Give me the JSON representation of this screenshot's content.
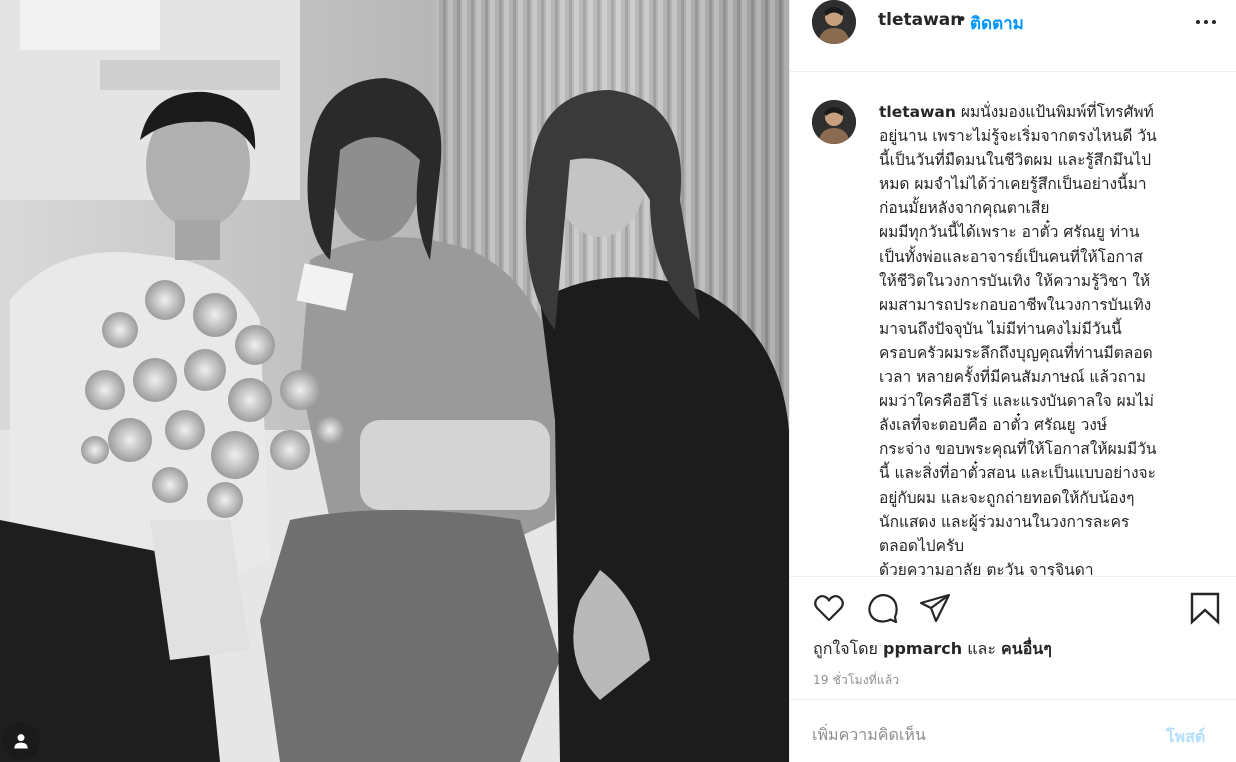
{
  "post": {
    "username": "tletawan",
    "separator": "•",
    "follow_label": "ติดตาม",
    "more_icon": "more-horizontal-icon"
  },
  "caption": {
    "username": "tletawan",
    "lines": [
      "ผมนั่งมองแป้นพิมพ์ที่โทรศัพท์",
      "อยู่นาน เพราะไม่รู้จะเริ่มจากตรงไหนดี วัน",
      "นี้เป็นวันที่มืดมนในชีวิตผม และรู้สึกมึนไป",
      "หมด ผมจำไม่ได้ว่าเคยรู้สึกเป็นอย่างนี้มา",
      "ก่อนมั้ยหลังจากคุณตาเสีย",
      "ผมมีทุกวันนี้ได้เพราะ อาตั๋ว ศรัณยู ท่าน",
      "เป็นทั้งพ่อและอาจารย์เป็นคนที่ให้โอกาส",
      "ให้ชีวิตในวงการบันเทิง ให้ความรู้วิชา ให้",
      "ผมสามารถประกอบอาชีพในวงการบันเทิง",
      "มาจนถึงปัจจุบัน ไม่มีท่านคงไม่มีวันนี้",
      "ครอบครัวผมระลึกถึงบุญคุณที่ท่านมีตลอด",
      "เวลา หลายครั้งที่มีคนสัมภาษณ์ แล้วถาม",
      "ผมว่าใครคือฮีโร่ และแรงบันดาลใจ ผมไม่",
      "ลังเลที่จะตอบคือ อาตั๋ว ศรัณยู วงษ์",
      "กระจ่าง ขอบพระคุณที่ให้โอกาสให้ผมมีวัน",
      "นี้ และสิ่งที่อาตั๋วสอน และเป็นแบบอย่างจะ",
      "อยู่กับผม และจะถูกถ่ายทอดให้กับน้องๆ",
      "นักแสดง และผู้ร่วมงานในวงการละคร",
      "ตลอดไปครับ",
      "ด้วยความอาลัย ตะวัน จารุจินดา"
    ]
  },
  "actions": {
    "like_icon": "heart-icon",
    "comment_icon": "comment-bubble-icon",
    "share_icon": "paper-plane-icon",
    "save_icon": "bookmark-icon"
  },
  "likes": {
    "prefix": "ถูกใจโดย ",
    "first_user": "ppmarch",
    "connector": " และ ",
    "others": "คนอื่นๆ"
  },
  "time_ago": "19 ชั่วโมงที่แล้ว",
  "comment": {
    "placeholder": "เพิ่มความคิดเห็น",
    "post_label": "โพสต์"
  },
  "photo": {
    "user_tag_icon": "user-tag-icon"
  }
}
